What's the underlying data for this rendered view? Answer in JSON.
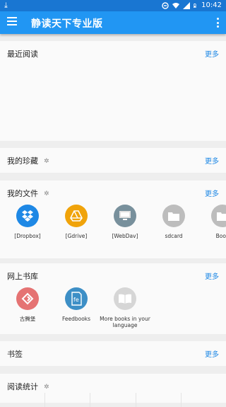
{
  "status": {
    "time": "10:42"
  },
  "app": {
    "title": "静读天下专业版"
  },
  "recent": {
    "title": "最近阅读",
    "more": "更多"
  },
  "favorites": {
    "title": "我的珍藏",
    "more": "更多"
  },
  "files": {
    "title": "我的文件",
    "more": "更多",
    "items": [
      {
        "label": "[Dropbox]",
        "color": "#1e88e5",
        "icon": "dropbox-icon"
      },
      {
        "label": "[Gdrive]",
        "color": "#f0a30a",
        "icon": "gdrive-icon"
      },
      {
        "label": "[WebDav]",
        "color": "#78909c",
        "icon": "webdav-icon"
      },
      {
        "label": "sdcard",
        "color": "#bdbdbd",
        "icon": "folder-icon"
      },
      {
        "label": "Book",
        "color": "#bdbdbd",
        "icon": "folder-icon"
      }
    ]
  },
  "online": {
    "title": "网上书库",
    "more": "更多",
    "items": [
      {
        "label": "古腾堡",
        "color": "#e57373",
        "icon": "gutenberg-icon"
      },
      {
        "label": "Feedbooks",
        "color": "#3d8fc6",
        "icon": "feedbooks-icon"
      },
      {
        "label": "More books in your language",
        "color": "#d6d6d6",
        "icon": "book-icon"
      }
    ]
  },
  "bookmarks": {
    "title": "书签",
    "more": "更多"
  },
  "stats": {
    "title": "阅读统计"
  }
}
